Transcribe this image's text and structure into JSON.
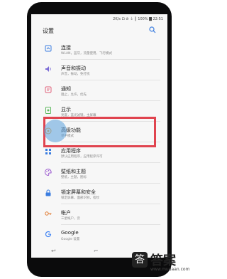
{
  "status": {
    "text": "2K/s ⊡ ⊘ ⏚ ║ 100% ▇ 22:51"
  },
  "header": {
    "title": "设置"
  },
  "items": [
    {
      "name": "连接",
      "sub": "WLAN，蓝牙，流量使用，飞行模式"
    },
    {
      "name": "声音和振动",
      "sub": "声音，振动，免打扰"
    },
    {
      "name": "通知",
      "sub": "阻止，允许，优先"
    },
    {
      "name": "显示",
      "sub": "亮度，蓝光滤镜，主屏幕"
    },
    {
      "name": "高级功能",
      "sub": "单手模式"
    },
    {
      "name": "应用程序",
      "sub": "默认应用程序，应用程序许可"
    },
    {
      "name": "壁纸和主题",
      "sub": "壁纸，主题，图标"
    },
    {
      "name": "锁定屏幕和安全",
      "sub": "锁定屏幕，面部识别，指纹"
    },
    {
      "name": "帐户",
      "sub": "三星帐户，云"
    },
    {
      "name": "Google",
      "sub": "Google 设置"
    }
  ],
  "navbar": {
    "back": "↩",
    "recent": "⌐"
  },
  "watermark": {
    "logo": "答",
    "text": "答案",
    "sub": "www.mudaan.com"
  },
  "icons": [
    "wifi-icon",
    "speaker-icon",
    "bell-icon",
    "display-icon",
    "advanced-icon",
    "apps-icon",
    "palette-icon",
    "lock-icon",
    "key-icon",
    "google-icon"
  ]
}
